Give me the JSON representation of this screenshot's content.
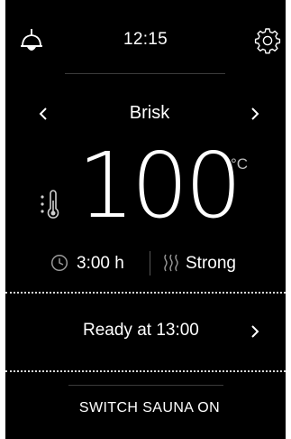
{
  "header": {
    "time": "12:15",
    "light_icon": "ceiling-lamp-icon",
    "settings_icon": "gear-icon"
  },
  "program": {
    "name": "Brisk",
    "prev_icon": "chevron-left-icon",
    "next_icon": "chevron-right-icon"
  },
  "temperature": {
    "value": "100",
    "unit": "°C",
    "icon": "thermometer-icon"
  },
  "session": {
    "duration": "3:00 h",
    "duration_icon": "clock-icon",
    "intensity": "Strong",
    "intensity_icon": "heat-waves-icon"
  },
  "schedule": {
    "label": "Ready at 13:00",
    "arrow_icon": "chevron-right-icon"
  },
  "power": {
    "label": "SWITCH SAUNA ON"
  },
  "colors": {
    "background": "#000000",
    "text": "#ffffff",
    "divider": "#3a3a3a",
    "dotted_separator": "#d8d8d8"
  }
}
